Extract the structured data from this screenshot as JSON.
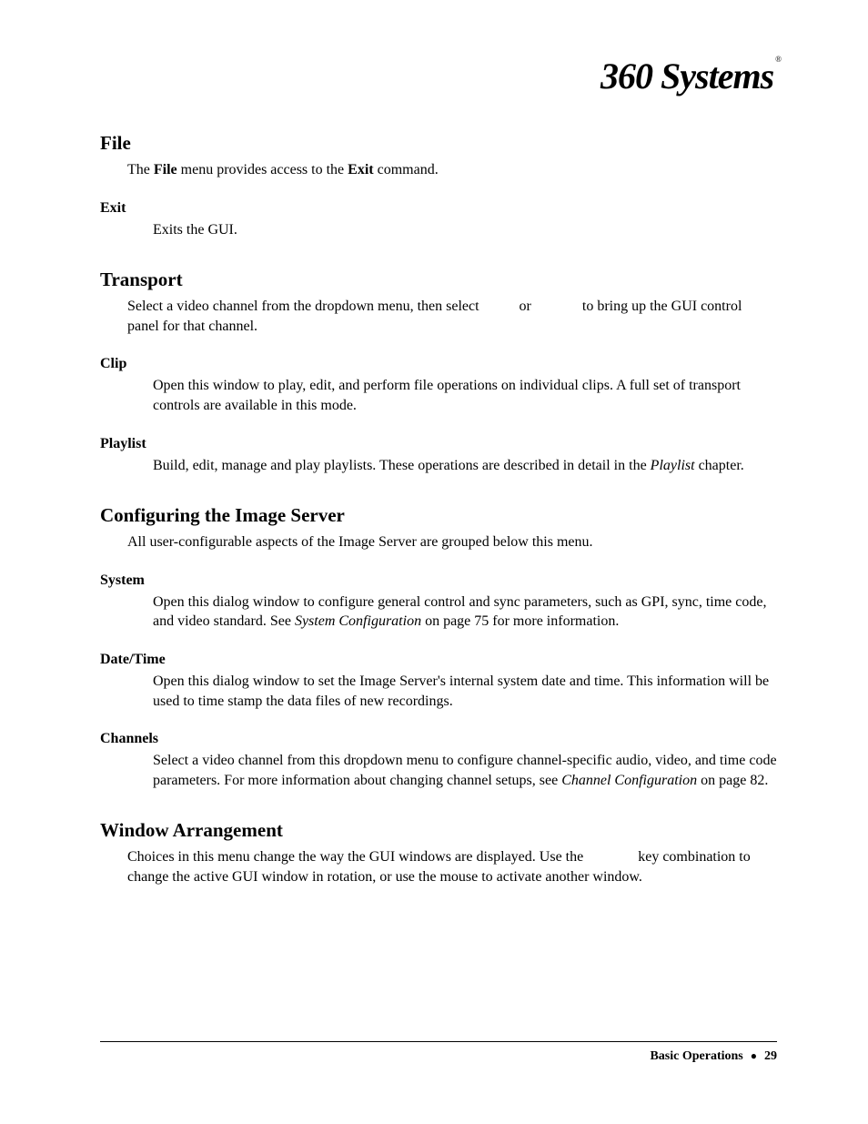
{
  "logo": {
    "text": "360 Systems",
    "mark": "®"
  },
  "sections": {
    "file": {
      "title": "File",
      "intro_pre": "The ",
      "intro_b1": "File",
      "intro_mid": " menu provides access to the ",
      "intro_b2": "Exit",
      "intro_post": " command.",
      "exit": {
        "title": "Exit",
        "body": "Exits the GUI."
      }
    },
    "transport": {
      "title": "Transport",
      "intro_pre": "Select a video channel from the dropdown menu, then select ",
      "intro_gap1": "          ",
      "intro_or": "or",
      "intro_gap2": "              ",
      "intro_post": "to bring up the GUI control panel for that channel.",
      "clip": {
        "title": "Clip",
        "body": "Open this window to play, edit, and perform file operations on individual clips.  A full set of transport controls are available in this mode."
      },
      "playlist": {
        "title": "Playlist",
        "body_pre": "Build, edit, manage and play playlists.  These operations are described in detail in the ",
        "body_i": "Playlist",
        "body_post": " chapter."
      }
    },
    "config": {
      "title": "Configuring the Image Server",
      "intro": "All user-configurable aspects of the Image Server are grouped below this menu.",
      "system": {
        "title": "System",
        "body_pre": "Open this dialog window to configure general control and sync parameters, such as GPI, sync, time code, and video standard.  See ",
        "body_i": "System Configuration",
        "body_post": " on page 75 for more information."
      },
      "datetime": {
        "title": "Date/Time",
        "body": "Open this dialog window to set the Image Server's internal system date and time.  This information will be used to time stamp the data files of new recordings."
      },
      "channels": {
        "title": "Channels",
        "body_pre": "Select a video channel from this dropdown menu to configure channel-specific audio, video, and time code parameters.  For more information about changing channel setups, see ",
        "body_i": "Channel Configuration",
        "body_post": " on page 82."
      }
    },
    "window": {
      "title": "Window Arrangement",
      "intro_pre": "Choices in this menu change the way the GUI windows are displayed.  Use the ",
      "intro_gap": "              ",
      "intro_post": "key combination to change the active GUI window in rotation, or use the mouse to activate another window."
    }
  },
  "footer": {
    "label": "Basic Operations",
    "bullet": "●",
    "page": "29"
  }
}
